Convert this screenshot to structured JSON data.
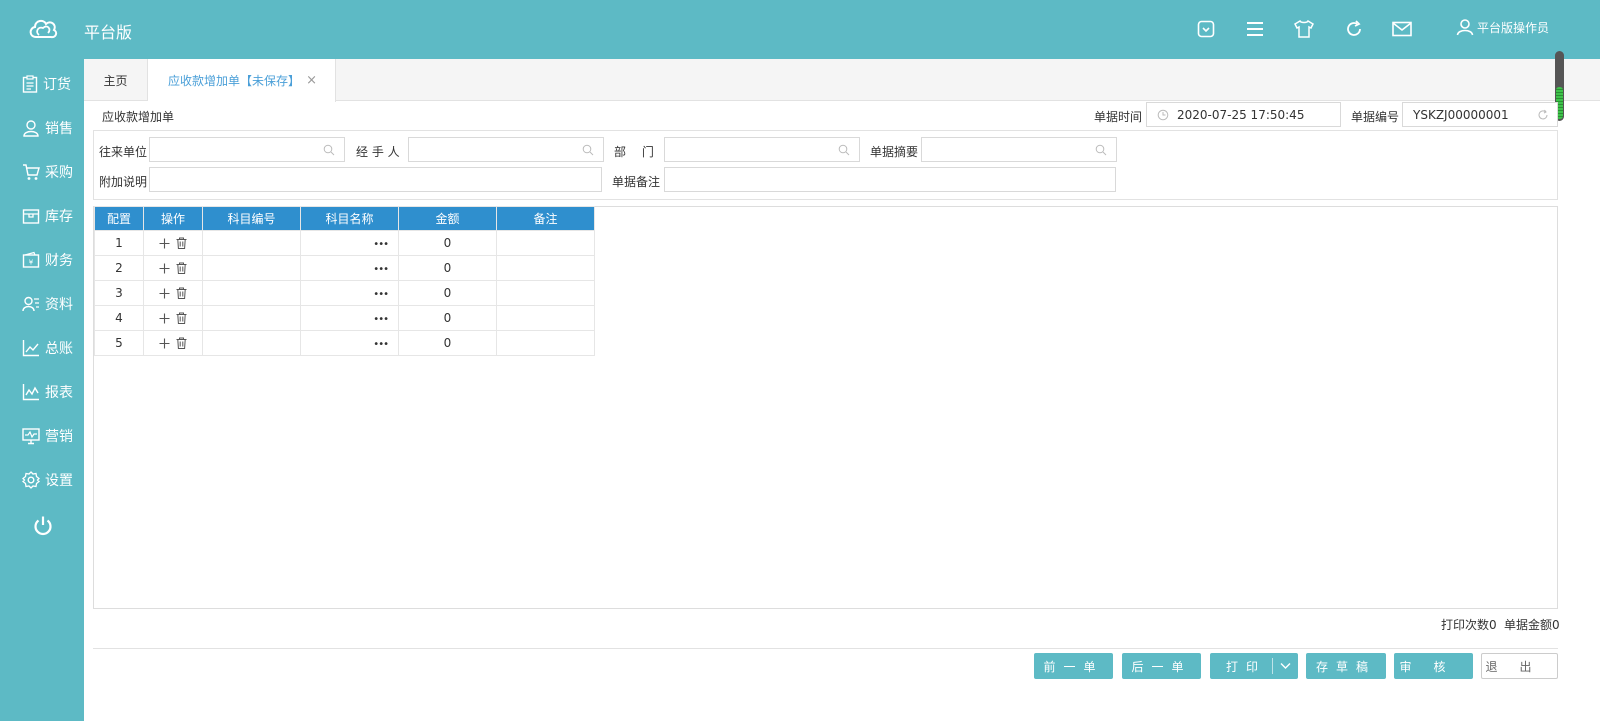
{
  "app": {
    "title": "平台版"
  },
  "header": {
    "user": "平台版操作员",
    "icons": [
      "dropdown-box-icon",
      "menu-icon",
      "shirt-icon",
      "refresh-icon",
      "mail-icon",
      "user-icon"
    ]
  },
  "sidebar": {
    "items": [
      {
        "label": "订货",
        "icon": "clipboard-icon"
      },
      {
        "label": "销售",
        "icon": "person-icon"
      },
      {
        "label": "采购",
        "icon": "cart-icon"
      },
      {
        "label": "库存",
        "icon": "box-icon"
      },
      {
        "label": "财务",
        "icon": "wallet-icon"
      },
      {
        "label": "资料",
        "icon": "contact-icon"
      },
      {
        "label": "总账",
        "icon": "line-chart-icon"
      },
      {
        "label": "报表",
        "icon": "report-chart-icon"
      },
      {
        "label": "营销",
        "icon": "monitor-icon"
      },
      {
        "label": "设置",
        "icon": "gear-icon"
      }
    ],
    "power_icon": "power-icon"
  },
  "tabs": {
    "home": "主页",
    "active": "应收款增加单【未保存】",
    "close": "×"
  },
  "form": {
    "title": "应收款增加单",
    "date_label": "单据时间",
    "date_value": "2020-07-25 17:50:45",
    "number_label": "单据编号",
    "number_value": "YSKZJ00000001",
    "partner_label": "往来单位",
    "handler_label": "经 手 人",
    "dept_label": "部　 门",
    "summary_label": "单据摘要",
    "extra_label": "附加说明",
    "remark_label": "单据备注"
  },
  "grid": {
    "headers": [
      "配置",
      "操作",
      "科目编号",
      "科目名称",
      "金额",
      "备注"
    ],
    "rows": [
      {
        "no": "1",
        "name_btn": "•••",
        "amount": "0"
      },
      {
        "no": "2",
        "name_btn": "•••",
        "amount": "0"
      },
      {
        "no": "3",
        "name_btn": "•••",
        "amount": "0"
      },
      {
        "no": "4",
        "name_btn": "•••",
        "amount": "0"
      },
      {
        "no": "5",
        "name_btn": "•••",
        "amount": "0"
      }
    ]
  },
  "footer": {
    "print_count": "打印次数0",
    "total_amount": "单据金额0",
    "buttons": {
      "prev": "前一单",
      "next": "后一单",
      "print": "打印",
      "draft": "存草稿",
      "audit": "审核",
      "exit": "退出"
    }
  },
  "colors": {
    "primary": "#5dbac5",
    "table_header": "#2f8fce",
    "tab_active": "#4a9fd8"
  }
}
